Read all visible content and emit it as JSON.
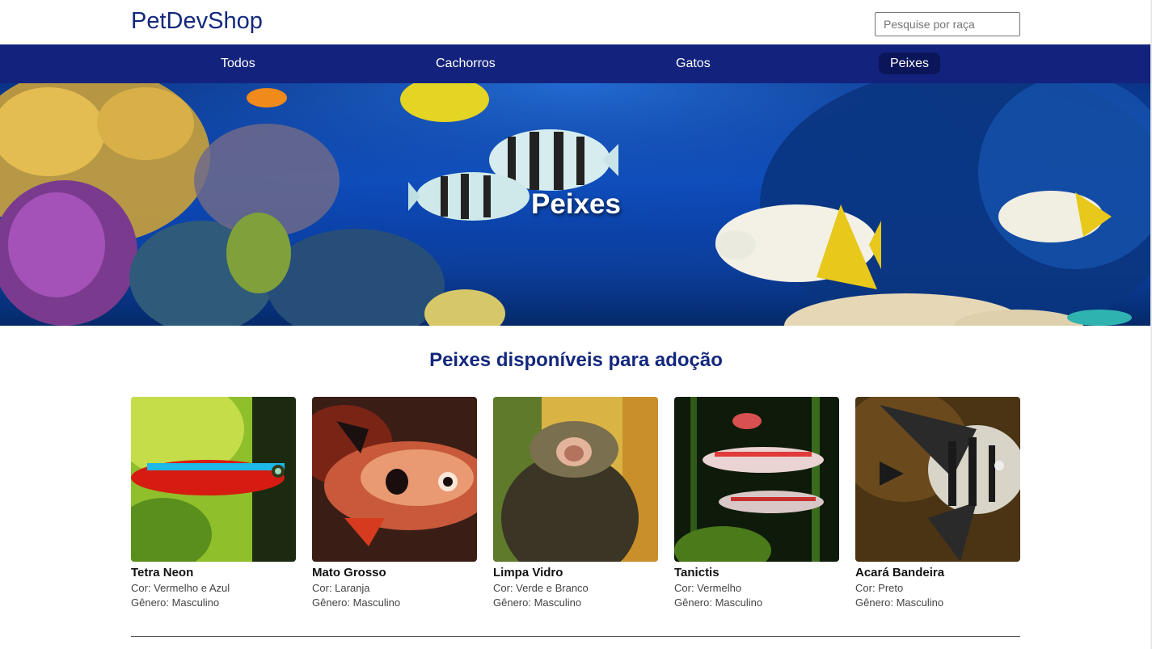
{
  "header": {
    "logo": "PetDevShop",
    "search_placeholder": "Pesquise por raça"
  },
  "nav": {
    "items": [
      {
        "label": "Todos"
      },
      {
        "label": "Cachorros"
      },
      {
        "label": "Gatos"
      },
      {
        "label": "Peixes",
        "active": true
      }
    ]
  },
  "hero": {
    "title": "Peixes"
  },
  "section": {
    "title": "Peixes disponíveis para adoção"
  },
  "pets": [
    {
      "name": "Tetra Neon",
      "color": "Cor: Vermelho e Azul",
      "gender": "Gênero: Masculino"
    },
    {
      "name": "Mato Grosso",
      "color": "Cor: Laranja",
      "gender": "Gênero: Masculino"
    },
    {
      "name": "Limpa Vidro",
      "color": "Cor: Verde e Branco",
      "gender": "Gênero: Masculino"
    },
    {
      "name": "Tanictis",
      "color": "Cor: Vermelho",
      "gender": "Gênero: Masculino"
    },
    {
      "name": "Acará Bandeira",
      "color": "Cor: Preto",
      "gender": "Gênero: Masculino"
    }
  ]
}
